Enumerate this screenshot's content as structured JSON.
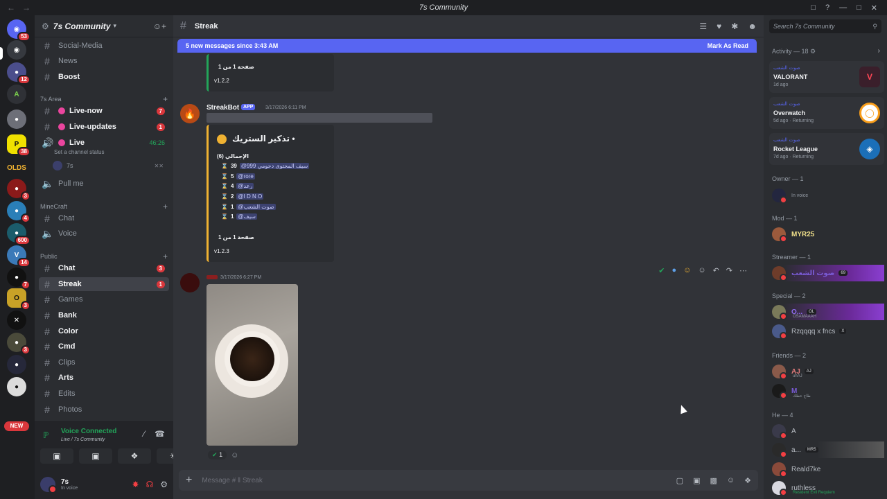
{
  "window": {
    "title": "7s Community"
  },
  "guild": {
    "name": "7s Community"
  },
  "rail": {
    "badges": [
      "53",
      "12",
      "38",
      "3",
      "4",
      "600",
      "14",
      "7",
      "3",
      "3"
    ],
    "olds_label": "OLDS",
    "new_label": "NEW"
  },
  "channels": {
    "top": [
      {
        "name": "Social-Media"
      },
      {
        "name": "News"
      },
      {
        "name": "Boost"
      }
    ],
    "cat_7s": "7s Area",
    "live_now": "Live-now",
    "live_now_count": "7",
    "live_updates": "Live-updates",
    "live_updates_count": "1",
    "live": "Live",
    "live_time": "46:26",
    "set_status": "Set a channel status",
    "voice_user": "7s",
    "pull_me": "Pull me",
    "cat_mc": "MineCraft",
    "mc_chat": "Chat",
    "mc_voice": "Voice",
    "cat_public": "Public",
    "chat": "Chat",
    "chat_count": "3",
    "streak": "Streak",
    "streak_count": "1",
    "games": "Games",
    "bank": "Bank",
    "color": "Color",
    "cmd": "Cmd",
    "clips": "Clips",
    "arts": "Arts",
    "edits": "Edits",
    "photos": "Photos"
  },
  "voice": {
    "status": "Voice Connected",
    "where": "Live / 7s Community"
  },
  "user": {
    "name": "7s",
    "status": "In voice"
  },
  "header": {
    "channel": "Streak"
  },
  "newbar": {
    "text": "5 new messages since 3:43 AM",
    "mark": "Mark As Read"
  },
  "embed1": {
    "page": "صفحة 1 من 1",
    "version": "v1.2.2"
  },
  "bot": {
    "name": "StreakBot",
    "app": "APP",
    "time": "3/17/2026 6:11 PM",
    "title": "تذكير الستريك •",
    "total": "الإجمالي (6)",
    "rows": [
      {
        "n": "39",
        "user": "@سيف المحتوى دحومي 999"
      },
      {
        "n": "5",
        "user": "@ɾoɾe"
      },
      {
        "n": "4",
        "user": "@رعد"
      },
      {
        "n": "2",
        "user": "@I D N O"
      },
      {
        "n": "1",
        "user": "@صوت الشعب"
      },
      {
        "n": "1",
        "user": "@سيف"
      }
    ],
    "page": "صفحة 1 من 1",
    "version": "v1.2.3"
  },
  "msg2": {
    "time": "3/17/2026 6:27 PM",
    "reaction_count": "1"
  },
  "composer": {
    "placeholder": "Message # ‖ Streak"
  },
  "right": {
    "search": "Search 7s Community",
    "activity_head": "Activity — 18",
    "activities": [
      {
        "source": "صوت الشعب",
        "game": "VALORANT",
        "meta": "1d ago"
      },
      {
        "source": "صوت الشعب",
        "game": "Overwatch",
        "meta": "5d ago · Returning"
      },
      {
        "source": "صوت الشعب",
        "game": "Rocket League",
        "meta": "7d ago · Returning"
      }
    ],
    "owner_head": "Owner — 1",
    "owner_status": "In voice",
    "mod_head": "Mod — 1",
    "mod_name": "MYR25",
    "streamer_head": "Streamer — 1",
    "streamer_name": "صوت الشعب",
    "streamer_tag": "69",
    "special_head": "Special — 2",
    "special1": "O...",
    "special1_tag": "OL",
    "special1_sub": "OSAMAAAH",
    "special2": "Rzqqqq x fncs",
    "special2_tag": "X",
    "friends_head": "Friends — 2",
    "friend1": "AJ",
    "friend1_tag": "AJ",
    "friend1_sub": "uhAJ",
    "friend2": "M",
    "friend2_sub": "طاح حظك",
    "he_head": "He — 4",
    "he1": "A",
    "he2": "a...",
    "he2_tag": "MR5",
    "he3": "Reald7ke",
    "he4": "ruthless",
    "he4_sub": "Resident Evil Requiem"
  }
}
